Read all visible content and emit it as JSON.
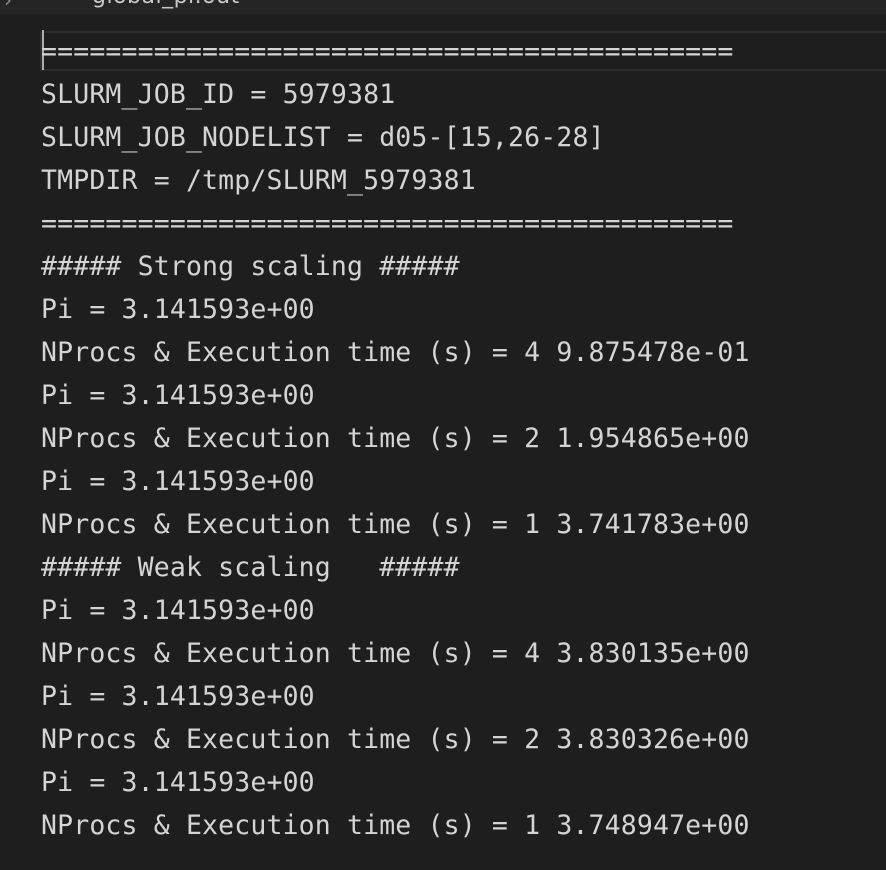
{
  "tab": {
    "title": "global_pi.out"
  },
  "lines": [
    "===========================================",
    "SLURM_JOB_ID = 5979381",
    "SLURM_JOB_NODELIST = d05-[15,26-28]",
    "TMPDIR = /tmp/SLURM_5979381",
    "===========================================",
    "##### Strong scaling #####",
    "Pi = 3.141593e+00",
    "NProcs & Execution time (s) = 4 9.875478e-01",
    "Pi = 3.141593e+00",
    "NProcs & Execution time (s) = 2 1.954865e+00",
    "Pi = 3.141593e+00",
    "NProcs & Execution time (s) = 1 3.741783e+00",
    "##### Weak scaling   #####",
    "Pi = 3.141593e+00",
    "NProcs & Execution time (s) = 4 3.830135e+00",
    "Pi = 3.141593e+00",
    "NProcs & Execution time (s) = 2 3.830326e+00",
    "Pi = 3.141593e+00",
    "NProcs & Execution time (s) = 1 3.748947e+00"
  ]
}
